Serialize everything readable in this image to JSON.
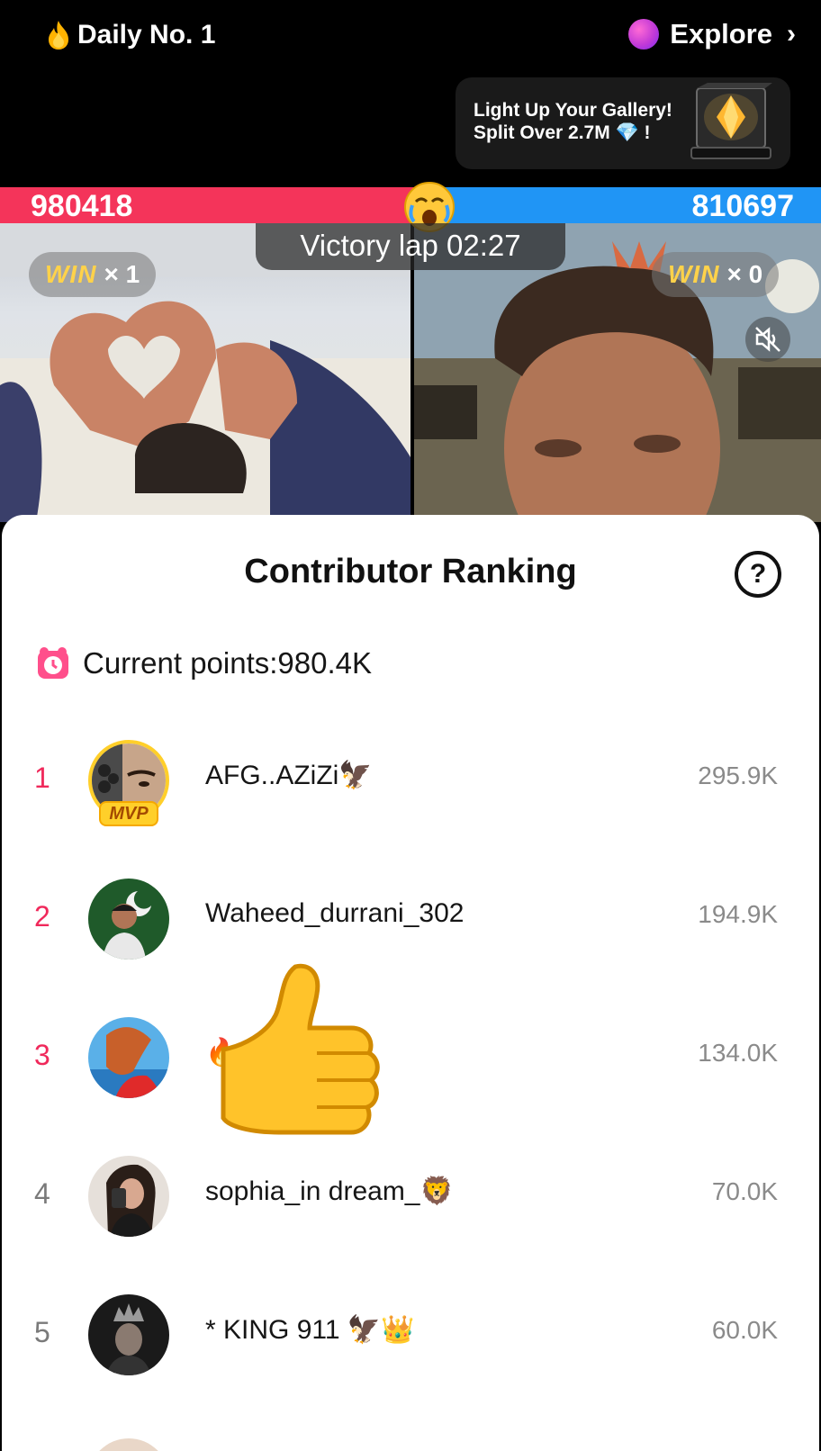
{
  "topbar": {
    "daily_label": "Daily No. 1",
    "explore_label": "Explore",
    "explore_chevron": "›"
  },
  "promo": {
    "line1": "Light Up Your Gallery!",
    "line2": "Split Over 2.7M 💎 !"
  },
  "battle": {
    "score_left": "980418",
    "score_right": "810697",
    "victory_label": "Victory lap 02:27",
    "win_left": {
      "label": "WIN",
      "count": "× 1"
    },
    "win_right": {
      "label": "WIN",
      "count": "× 0"
    }
  },
  "ranking": {
    "title": "Contributor Ranking",
    "help_symbol": "?",
    "current_points_label": "Current points:980.4K",
    "mvp_badge": "MVP",
    "rows": [
      {
        "rank": "1",
        "name": "AFG..AZiZi🦅",
        "score": "295.9K"
      },
      {
        "rank": "2",
        "name": "Waheed_durrani_302",
        "score": "194.9K"
      },
      {
        "rank": "3",
        "name": "🔥          👸🏼✨🔥...",
        "score": "134.0K"
      },
      {
        "rank": "4",
        "name": "sophia_in dream_🦁",
        "score": "70.0K"
      },
      {
        "rank": "5",
        "name": "* KING 911 🦅👑",
        "score": "60.0K"
      }
    ]
  },
  "colors": {
    "accent_red": "#f4345a",
    "accent_blue": "#2095f5",
    "rank_highlight": "#f0295b",
    "win_gold": "#ffd24a"
  },
  "icons": [
    "flame-icon",
    "explore-orb-icon",
    "chevron-right-icon",
    "gem-icon",
    "crying-face-icon",
    "mute-icon",
    "help-icon",
    "clock-icon",
    "thumbs-up-icon"
  ]
}
